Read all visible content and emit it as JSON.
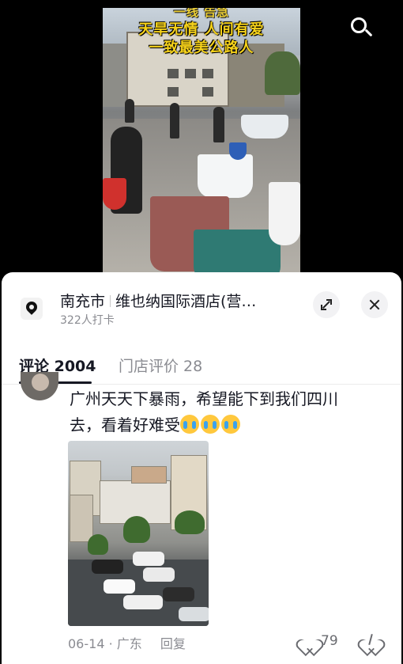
{
  "video": {
    "caption_top": "一线 告急",
    "caption_line1": "天旱无情 人间有爱",
    "caption_line2": "一致最美公路人"
  },
  "location": {
    "city": "南充市",
    "name": "维也纳国际酒店(营…",
    "checkins": "322人打卡"
  },
  "tabs": {
    "comments": "评论 2004",
    "reviews": "门店评价 28"
  },
  "comment": {
    "text_line1": "广州天天下暴雨，希望能下到我们四川",
    "text_line2": "去，看着好难受",
    "emoji_count": 3,
    "date": "06-14",
    "dot": "·",
    "region": "广东",
    "reply_label": "回复",
    "likes": "79"
  },
  "colors": {
    "caption_yellow": "#f6d21a",
    "text_primary": "#161823",
    "text_secondary": "#8a8b91"
  },
  "icons": [
    "search-icon",
    "location-pin-icon",
    "expand-icon",
    "close-icon",
    "heart-icon",
    "dislike-icon",
    "crying-emoji-icon"
  ]
}
